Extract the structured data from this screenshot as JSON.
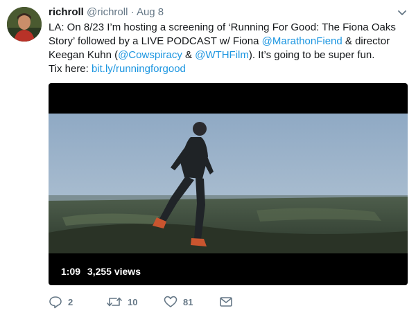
{
  "tweet": {
    "author_name": "richroll",
    "author_handle": "@richroll",
    "separator": "·",
    "timestamp": "Aug 8",
    "text": {
      "line1": "LA: On 8/23 I’m hosting a screening of ‘Running For Good: The Fiona Oaks",
      "line2_a": "Story’ followed by a LIVE PODCAST w/ Fiona ",
      "mention1": "@MarathonFiend",
      "line2_b": " & director",
      "line3_a": "Keegan Kuhn (",
      "mention2": "@Cowspiracy",
      "line3_b": " & ",
      "mention3": "@WTHFilm",
      "line3_c": "). It’s going to be super fun.",
      "line4_a": "Tix here: ",
      "link": "bit.ly/runningforgood"
    }
  },
  "media": {
    "type": "video",
    "duration": "1:09",
    "views": "3,255 views"
  },
  "actions": {
    "replies": "2",
    "retweets": "10",
    "likes": "81",
    "reply_icon": "reply-icon",
    "retweet_icon": "retweet-icon",
    "like_icon": "heart-icon",
    "dm_icon": "envelope-icon"
  },
  "colors": {
    "link": "#1b95e0",
    "muted": "#657786",
    "text": "#14171a"
  }
}
